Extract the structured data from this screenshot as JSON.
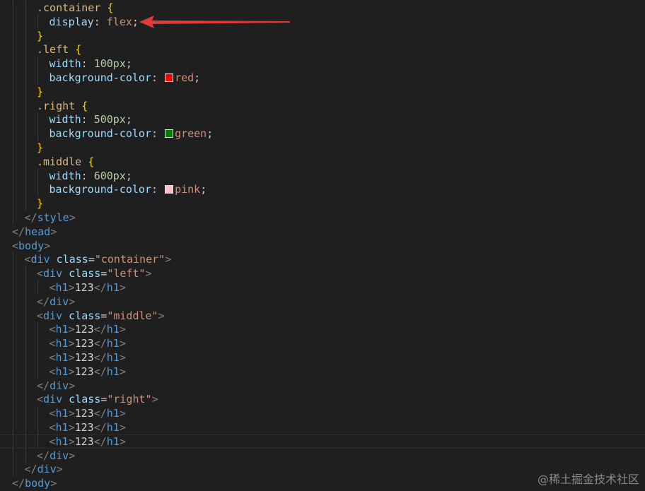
{
  "editor": {
    "lines": [
      {
        "indent": 3,
        "tokens": [
          {
            "t": ".container",
            "c": "selector"
          },
          {
            "t": " ",
            "c": "punct"
          },
          {
            "t": "{",
            "c": "brace"
          }
        ]
      },
      {
        "indent": 4,
        "tokens": [
          {
            "t": "display",
            "c": "prop"
          },
          {
            "t": ": ",
            "c": "punct"
          },
          {
            "t": "flex",
            "c": "kw"
          },
          {
            "t": ";",
            "c": "punct"
          }
        ]
      },
      {
        "indent": 3,
        "tokens": [
          {
            "t": "}",
            "c": "brace"
          }
        ]
      },
      {
        "indent": 3,
        "tokens": [
          {
            "t": ".left",
            "c": "selector"
          },
          {
            "t": " ",
            "c": "punct"
          },
          {
            "t": "{",
            "c": "brace"
          }
        ]
      },
      {
        "indent": 4,
        "tokens": [
          {
            "t": "width",
            "c": "prop"
          },
          {
            "t": ": ",
            "c": "punct"
          },
          {
            "t": "100px",
            "c": "num"
          },
          {
            "t": ";",
            "c": "punct"
          }
        ]
      },
      {
        "indent": 4,
        "tokens": [
          {
            "t": "background-color",
            "c": "prop"
          },
          {
            "t": ": ",
            "c": "punct"
          },
          {
            "swatch": "#ff0000"
          },
          {
            "t": "red",
            "c": "kw"
          },
          {
            "t": ";",
            "c": "punct"
          }
        ]
      },
      {
        "indent": 3,
        "tokens": [
          {
            "t": "}",
            "c": "brace"
          }
        ]
      },
      {
        "indent": 3,
        "tokens": [
          {
            "t": ".right",
            "c": "selector"
          },
          {
            "t": " ",
            "c": "punct"
          },
          {
            "t": "{",
            "c": "brace"
          }
        ]
      },
      {
        "indent": 4,
        "tokens": [
          {
            "t": "width",
            "c": "prop"
          },
          {
            "t": ": ",
            "c": "punct"
          },
          {
            "t": "500px",
            "c": "num"
          },
          {
            "t": ";",
            "c": "punct"
          }
        ]
      },
      {
        "indent": 4,
        "tokens": [
          {
            "t": "background-color",
            "c": "prop"
          },
          {
            "t": ": ",
            "c": "punct"
          },
          {
            "swatch": "#008000"
          },
          {
            "t": "green",
            "c": "kw"
          },
          {
            "t": ";",
            "c": "punct"
          }
        ]
      },
      {
        "indent": 3,
        "tokens": [
          {
            "t": "}",
            "c": "brace"
          }
        ]
      },
      {
        "indent": 3,
        "tokens": [
          {
            "t": ".middle",
            "c": "selector"
          },
          {
            "t": " ",
            "c": "punct"
          },
          {
            "t": "{",
            "c": "brace"
          }
        ]
      },
      {
        "indent": 4,
        "tokens": [
          {
            "t": "width",
            "c": "prop"
          },
          {
            "t": ": ",
            "c": "punct"
          },
          {
            "t": "600px",
            "c": "num"
          },
          {
            "t": ";",
            "c": "punct"
          }
        ]
      },
      {
        "indent": 4,
        "tokens": [
          {
            "t": "background-color",
            "c": "prop"
          },
          {
            "t": ": ",
            "c": "punct"
          },
          {
            "swatch": "#ffc0cb"
          },
          {
            "t": "pink",
            "c": "kw"
          },
          {
            "t": ";",
            "c": "punct"
          }
        ]
      },
      {
        "indent": 3,
        "tokens": [
          {
            "t": "}",
            "c": "brace"
          }
        ]
      },
      {
        "indent": 2,
        "tokens": [
          {
            "t": "</",
            "c": "bracket"
          },
          {
            "t": "style",
            "c": "tag"
          },
          {
            "t": ">",
            "c": "bracket"
          }
        ]
      },
      {
        "indent": 1,
        "tokens": [
          {
            "t": "</",
            "c": "bracket"
          },
          {
            "t": "head",
            "c": "tag"
          },
          {
            "t": ">",
            "c": "bracket"
          }
        ]
      },
      {
        "indent": 1,
        "tokens": [
          {
            "t": "<",
            "c": "bracket"
          },
          {
            "t": "body",
            "c": "tag"
          },
          {
            "t": ">",
            "c": "bracket"
          }
        ]
      },
      {
        "indent": 2,
        "tokens": [
          {
            "t": "<",
            "c": "bracket"
          },
          {
            "t": "div",
            "c": "tag"
          },
          {
            "t": " ",
            "c": "punct"
          },
          {
            "t": "class",
            "c": "attr"
          },
          {
            "t": "=",
            "c": "punct"
          },
          {
            "t": "\"container\"",
            "c": "str"
          },
          {
            "t": ">",
            "c": "bracket"
          }
        ]
      },
      {
        "indent": 3,
        "tokens": [
          {
            "t": "<",
            "c": "bracket"
          },
          {
            "t": "div",
            "c": "tag"
          },
          {
            "t": " ",
            "c": "punct"
          },
          {
            "t": "class",
            "c": "attr"
          },
          {
            "t": "=",
            "c": "punct"
          },
          {
            "t": "\"left\"",
            "c": "str"
          },
          {
            "t": ">",
            "c": "bracket"
          }
        ]
      },
      {
        "indent": 4,
        "tokens": [
          {
            "t": "<",
            "c": "bracket"
          },
          {
            "t": "h1",
            "c": "tag"
          },
          {
            "t": ">",
            "c": "bracket"
          },
          {
            "t": "123",
            "c": "text"
          },
          {
            "t": "</",
            "c": "bracket"
          },
          {
            "t": "h1",
            "c": "tag"
          },
          {
            "t": ">",
            "c": "bracket"
          }
        ]
      },
      {
        "indent": 3,
        "tokens": [
          {
            "t": "</",
            "c": "bracket"
          },
          {
            "t": "div",
            "c": "tag"
          },
          {
            "t": ">",
            "c": "bracket"
          }
        ]
      },
      {
        "indent": 3,
        "tokens": [
          {
            "t": "<",
            "c": "bracket"
          },
          {
            "t": "div",
            "c": "tag"
          },
          {
            "t": " ",
            "c": "punct"
          },
          {
            "t": "class",
            "c": "attr"
          },
          {
            "t": "=",
            "c": "punct"
          },
          {
            "t": "\"middle\"",
            "c": "str"
          },
          {
            "t": ">",
            "c": "bracket"
          }
        ]
      },
      {
        "indent": 4,
        "tokens": [
          {
            "t": "<",
            "c": "bracket"
          },
          {
            "t": "h1",
            "c": "tag"
          },
          {
            "t": ">",
            "c": "bracket"
          },
          {
            "t": "123",
            "c": "text"
          },
          {
            "t": "</",
            "c": "bracket"
          },
          {
            "t": "h1",
            "c": "tag"
          },
          {
            "t": ">",
            "c": "bracket"
          }
        ]
      },
      {
        "indent": 4,
        "tokens": [
          {
            "t": "<",
            "c": "bracket"
          },
          {
            "t": "h1",
            "c": "tag"
          },
          {
            "t": ">",
            "c": "bracket"
          },
          {
            "t": "123",
            "c": "text"
          },
          {
            "t": "</",
            "c": "bracket"
          },
          {
            "t": "h1",
            "c": "tag"
          },
          {
            "t": ">",
            "c": "bracket"
          }
        ]
      },
      {
        "indent": 4,
        "tokens": [
          {
            "t": "<",
            "c": "bracket"
          },
          {
            "t": "h1",
            "c": "tag"
          },
          {
            "t": ">",
            "c": "bracket"
          },
          {
            "t": "123",
            "c": "text"
          },
          {
            "t": "</",
            "c": "bracket"
          },
          {
            "t": "h1",
            "c": "tag"
          },
          {
            "t": ">",
            "c": "bracket"
          }
        ]
      },
      {
        "indent": 4,
        "tokens": [
          {
            "t": "<",
            "c": "bracket"
          },
          {
            "t": "h1",
            "c": "tag"
          },
          {
            "t": ">",
            "c": "bracket"
          },
          {
            "t": "123",
            "c": "text"
          },
          {
            "t": "</",
            "c": "bracket"
          },
          {
            "t": "h1",
            "c": "tag"
          },
          {
            "t": ">",
            "c": "bracket"
          }
        ]
      },
      {
        "indent": 3,
        "tokens": [
          {
            "t": "</",
            "c": "bracket"
          },
          {
            "t": "div",
            "c": "tag"
          },
          {
            "t": ">",
            "c": "bracket"
          }
        ]
      },
      {
        "indent": 3,
        "tokens": [
          {
            "t": "<",
            "c": "bracket"
          },
          {
            "t": "div",
            "c": "tag"
          },
          {
            "t": " ",
            "c": "punct"
          },
          {
            "t": "class",
            "c": "attr"
          },
          {
            "t": "=",
            "c": "punct"
          },
          {
            "t": "\"right\"",
            "c": "str"
          },
          {
            "t": ">",
            "c": "bracket"
          }
        ]
      },
      {
        "indent": 4,
        "tokens": [
          {
            "t": "<",
            "c": "bracket"
          },
          {
            "t": "h1",
            "c": "tag"
          },
          {
            "t": ">",
            "c": "bracket"
          },
          {
            "t": "123",
            "c": "text"
          },
          {
            "t": "</",
            "c": "bracket"
          },
          {
            "t": "h1",
            "c": "tag"
          },
          {
            "t": ">",
            "c": "bracket"
          }
        ]
      },
      {
        "indent": 4,
        "tokens": [
          {
            "t": "<",
            "c": "bracket"
          },
          {
            "t": "h1",
            "c": "tag"
          },
          {
            "t": ">",
            "c": "bracket"
          },
          {
            "t": "123",
            "c": "text"
          },
          {
            "t": "</",
            "c": "bracket"
          },
          {
            "t": "h1",
            "c": "tag"
          },
          {
            "t": ">",
            "c": "bracket"
          }
        ]
      },
      {
        "indent": 4,
        "current": true,
        "tokens": [
          {
            "t": "<",
            "c": "bracket"
          },
          {
            "t": "h1",
            "c": "tag"
          },
          {
            "t": ">",
            "c": "bracket"
          },
          {
            "t": "123",
            "c": "text"
          },
          {
            "t": "</",
            "c": "bracket"
          },
          {
            "t": "h1",
            "c": "tag"
          },
          {
            "t": ">",
            "c": "bracket"
          }
        ]
      },
      {
        "indent": 3,
        "tokens": [
          {
            "t": "</",
            "c": "bracket"
          },
          {
            "t": "div",
            "c": "tag"
          },
          {
            "t": ">",
            "c": "bracket"
          }
        ]
      },
      {
        "indent": 2,
        "tokens": [
          {
            "t": "</",
            "c": "bracket"
          },
          {
            "t": "div",
            "c": "tag"
          },
          {
            "t": ">",
            "c": "bracket"
          }
        ]
      },
      {
        "indent": 1,
        "tokens": [
          {
            "t": "</",
            "c": "bracket"
          },
          {
            "t": "body",
            "c": "tag"
          },
          {
            "t": ">",
            "c": "bracket"
          }
        ]
      }
    ]
  },
  "annotation": {
    "type": "arrow",
    "color": "#e03a3a"
  },
  "watermark": "@稀土掘金技术社区"
}
